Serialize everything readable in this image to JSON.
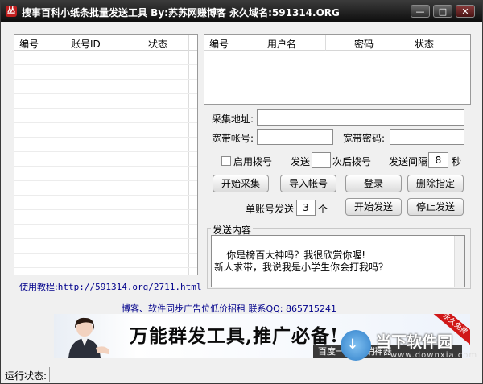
{
  "window": {
    "title": "搜事百科小纸条批量发送工具    By:苏苏网赚博客    永久域名:591314.ORG",
    "icon_glyph": "丛",
    "controls": {
      "minimize": "—",
      "maximize": "□",
      "close": "✕"
    }
  },
  "account_list": {
    "columns": [
      "编号",
      "账号ID",
      "状态"
    ],
    "rows": []
  },
  "user_list": {
    "columns": [
      "编号",
      "用户名",
      "密码",
      "状态"
    ],
    "rows": []
  },
  "form": {
    "collect_url_label": "采集地址:",
    "collect_url_value": "",
    "broadband_account_label": "宽带帐号:",
    "broadband_account_value": "",
    "broadband_password_label": "宽带密码:",
    "broadband_password_value": "",
    "enable_dial_label": "启用拨号",
    "enable_dial_checked": false,
    "send_label": "发送",
    "send_count_value": "",
    "after_dial_label": "次后拨号",
    "send_interval_label": "发送间隔",
    "send_interval_value": "8",
    "seconds_label": "秒",
    "per_account_label": "单账号发送",
    "per_account_value": "3",
    "per_account_unit": "个"
  },
  "buttons": {
    "start_collect": "开始采集",
    "import_account": "导入帐号",
    "login": "登录",
    "delete_specified": "删除指定",
    "start_send": "开始发送",
    "stop_send": "停止发送"
  },
  "content": {
    "label": "发送内容",
    "text": "你是榜百大神吗？我很欣赏你喔!\n新人求带，我说我是小学生你会打我吗？"
  },
  "tutorial": {
    "label": "使用教程:",
    "url": "http://591314.org/2711.html"
  },
  "ad": {
    "text": "博客、软件同步广告位低价招租    联系QQ: 865715241",
    "banner_slogan": "万能群发工具,推广必备!",
    "banner_search": "百度一下:营销神器",
    "banner_ribbon": "永久免费"
  },
  "watermark": {
    "cn": "当下软件园",
    "en": "www.downxia.com",
    "glyph": "↓"
  },
  "status_bar": {
    "label": "运行状态:",
    "value": ""
  },
  "colors": {
    "title_bg": "#1e1e1e",
    "link_text": "#00008b",
    "ribbon_red": "#d01818"
  }
}
